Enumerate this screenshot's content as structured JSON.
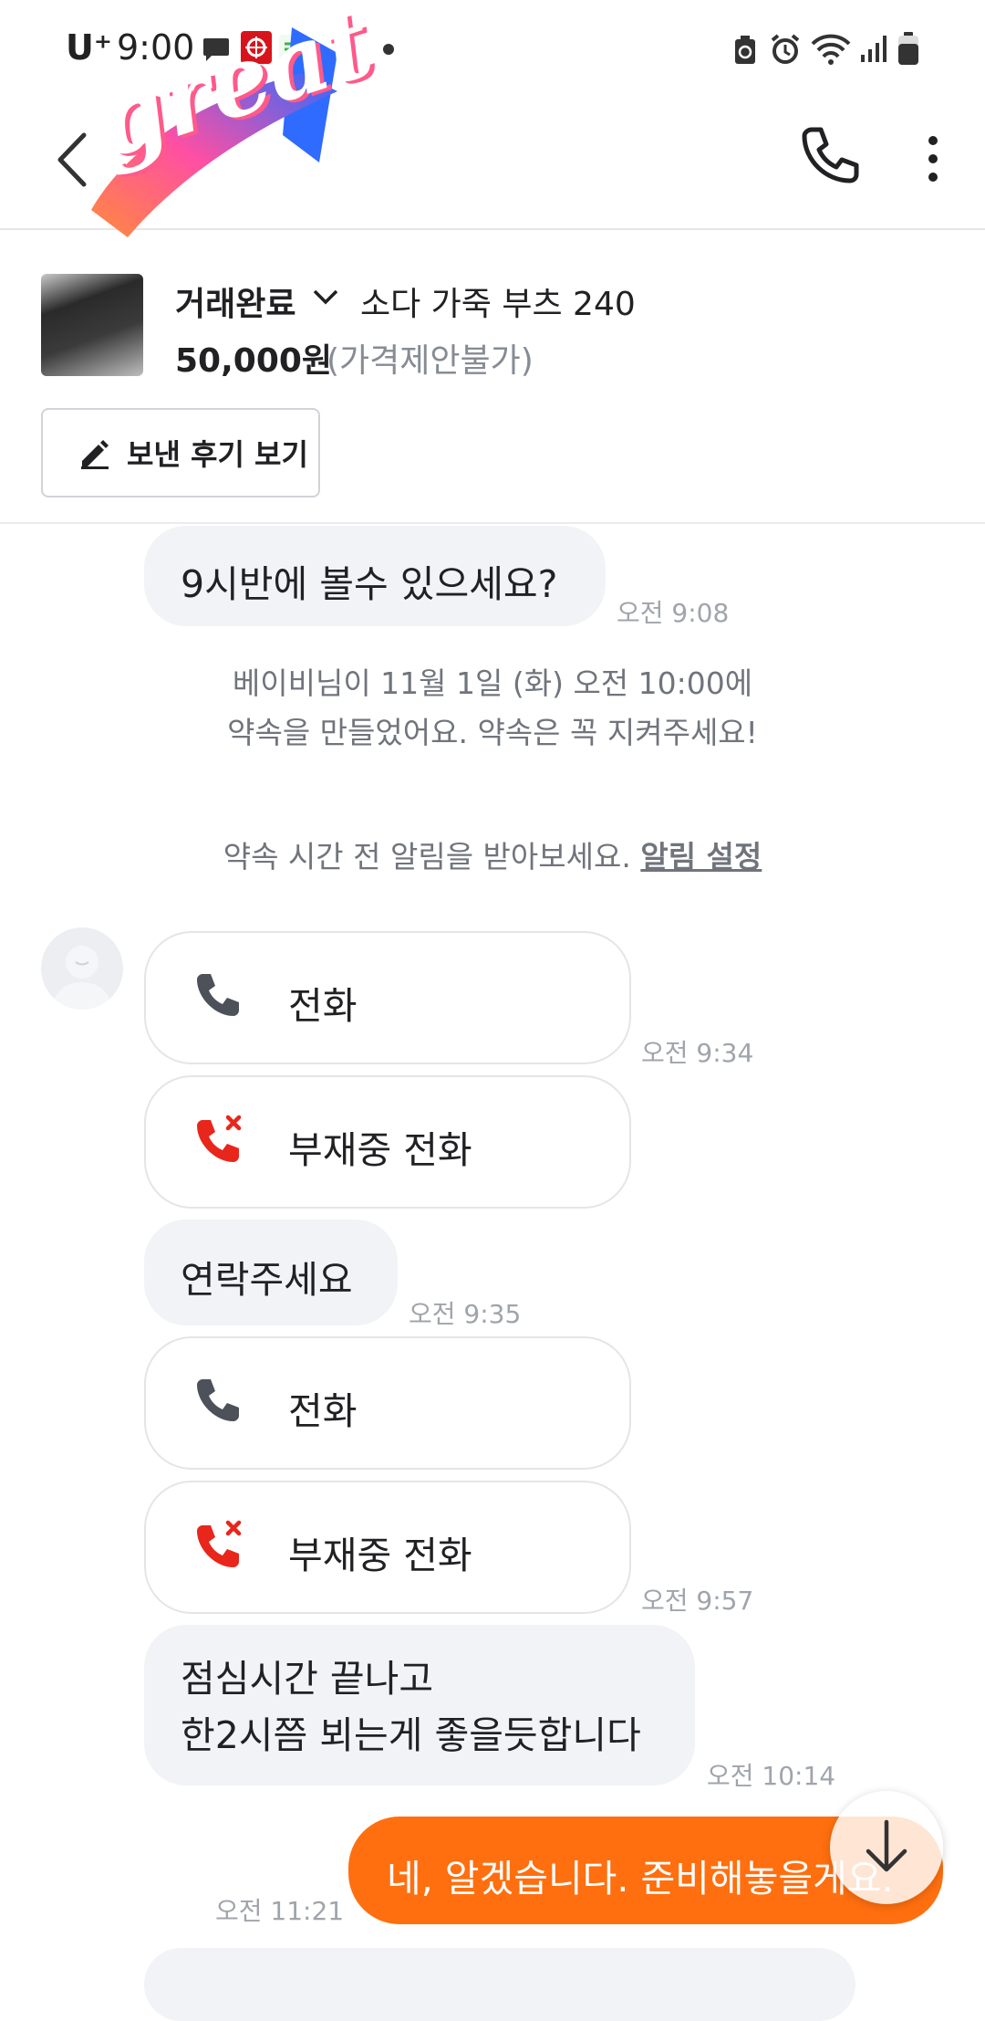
{
  "status_bar": {
    "carrier": "U⁺",
    "time": "9:00"
  },
  "sticker": {
    "text": "great"
  },
  "header": {
    "back_icon": "chevron-left-icon",
    "call_icon": "phone-icon",
    "more_icon": "kebab-icon"
  },
  "product": {
    "status": "거래완료",
    "title": "소다 가죽 부츠 240",
    "price": "50,000원",
    "price_note": "(가격제안불가)",
    "review_button": "보낸 후기 보기"
  },
  "messages": {
    "m1": {
      "text": "9시반에 볼수 있으세요?",
      "time": "오전 9:08"
    },
    "system_line1": "베이비님이 11월 1일 (화) 오전 10:00에",
    "system_line2": "약속을 만들었어요. 약속은 꼭 지켜주세요!",
    "reminder_text": "약속 시간 전 알림을 받아보세요.",
    "reminder_link": "알림 설정",
    "call1": {
      "text": "전화",
      "time": "오전 9:34"
    },
    "missed1": {
      "text": "부재중 전화"
    },
    "m2": {
      "text": "연락주세요",
      "time": "오전 9:35"
    },
    "call2": {
      "text": "전화"
    },
    "missed2": {
      "text": "부재중 전화",
      "time": "오전 9:57"
    },
    "m3": {
      "line1": "점심시간 끝나고",
      "line2": "한2시쯤 뵈는게 좋을듯합니다",
      "time": "오전 10:14"
    },
    "mine1": {
      "text": "네, 알겠습니다. 준비해놓을게요.",
      "time": "오전 11:21"
    }
  },
  "colors": {
    "accent": "#ff6f0f",
    "missed": "#e8261c",
    "bubble": "#f2f3f6"
  }
}
